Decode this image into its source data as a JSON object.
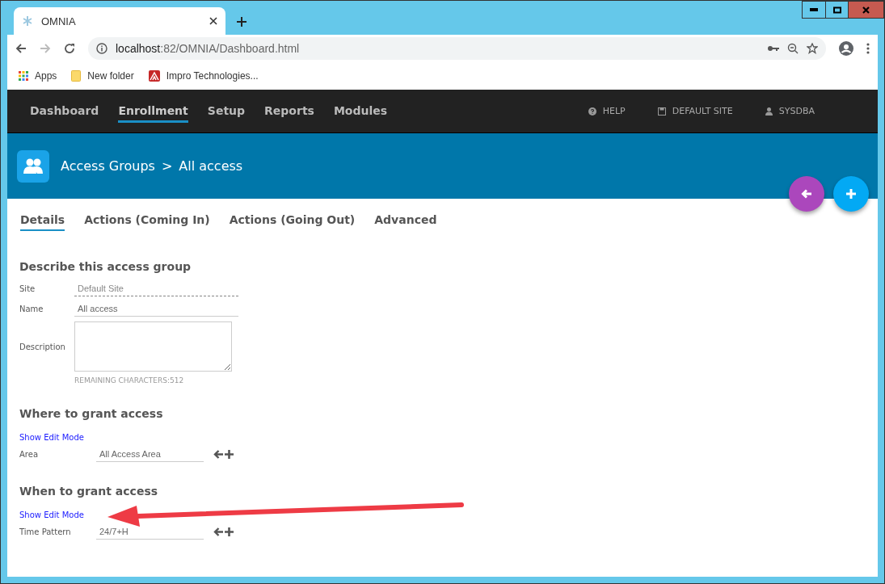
{
  "browser": {
    "tab_title": "OMNIA",
    "url_host": "localhost",
    "url_path": ":82/OMNIA/Dashboard.html",
    "bookmarks": [
      {
        "kind": "apps",
        "label": "Apps"
      },
      {
        "kind": "folder",
        "label": "New folder"
      },
      {
        "kind": "site",
        "label": "Impro Technologies..."
      }
    ]
  },
  "nav": {
    "items": [
      {
        "label": "Dashboard",
        "selected": false
      },
      {
        "label": "Enrollment",
        "selected": true
      },
      {
        "label": "Setup",
        "selected": false
      },
      {
        "label": "Reports",
        "selected": false
      },
      {
        "label": "Modules",
        "selected": false
      }
    ],
    "right": [
      {
        "kind": "help",
        "label": "HELP"
      },
      {
        "kind": "site",
        "label": "DEFAULT SITE"
      },
      {
        "kind": "user",
        "label": "SYSDBA"
      }
    ]
  },
  "header": {
    "parent": "Access Groups",
    "separator": ">",
    "current": "All access"
  },
  "tabs": [
    {
      "label": "Details",
      "selected": true
    },
    {
      "label": "Actions (Coming In)",
      "selected": false
    },
    {
      "label": "Actions (Going Out)",
      "selected": false
    },
    {
      "label": "Advanced",
      "selected": false
    }
  ],
  "describe": {
    "title": "Describe this access group",
    "site_label": "Site",
    "site_value": "Default Site",
    "name_label": "Name",
    "name_value": "All access",
    "description_label": "Description",
    "remaining": "REMAINING CHARACTERS:512"
  },
  "grants": [
    {
      "title": "Where to grant access",
      "link": "Show Edit Mode",
      "label": "Area",
      "value": "All Access Area"
    },
    {
      "title": "When to grant access",
      "link": "Show Edit Mode",
      "label": "Time Pattern",
      "value": "24/7+H"
    }
  ]
}
